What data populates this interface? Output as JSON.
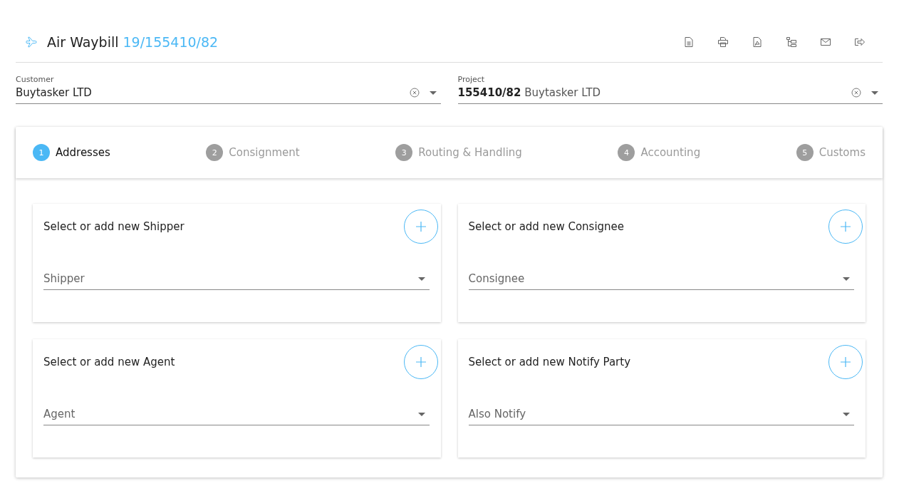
{
  "header": {
    "title": "Air Waybill",
    "number": "19/155410/82",
    "actions": [
      {
        "kind": "document"
      },
      {
        "kind": "print"
      },
      {
        "kind": "pdf"
      },
      {
        "kind": "tree"
      },
      {
        "kind": "mail"
      },
      {
        "kind": "export"
      }
    ]
  },
  "fields": [
    {
      "label": "Customer",
      "value": "Buytasker LTD"
    },
    {
      "label": "Project",
      "value": "**155410/82** Buytasker LTD"
    }
  ],
  "steps": [
    {
      "number": "1",
      "label": "Addresses",
      "selected": true
    },
    {
      "number": "2",
      "label": "Consignment",
      "selected": false
    },
    {
      "number": "3",
      "label": "Routing & Handling",
      "selected": false
    },
    {
      "number": "4",
      "label": "Accounting",
      "selected": false
    },
    {
      "number": "5",
      "label": "Customs",
      "selected": false
    }
  ],
  "cards": [
    {
      "title": "Select or add new Shipper",
      "placeholder": "Shipper"
    },
    {
      "title": "Select or add new Consignee",
      "placeholder": "Consignee"
    },
    {
      "title": "Select or add new Agent",
      "placeholder": "Agent"
    },
    {
      "title": "Select or add new Notify Party",
      "placeholder": "Also Notify"
    }
  ]
}
